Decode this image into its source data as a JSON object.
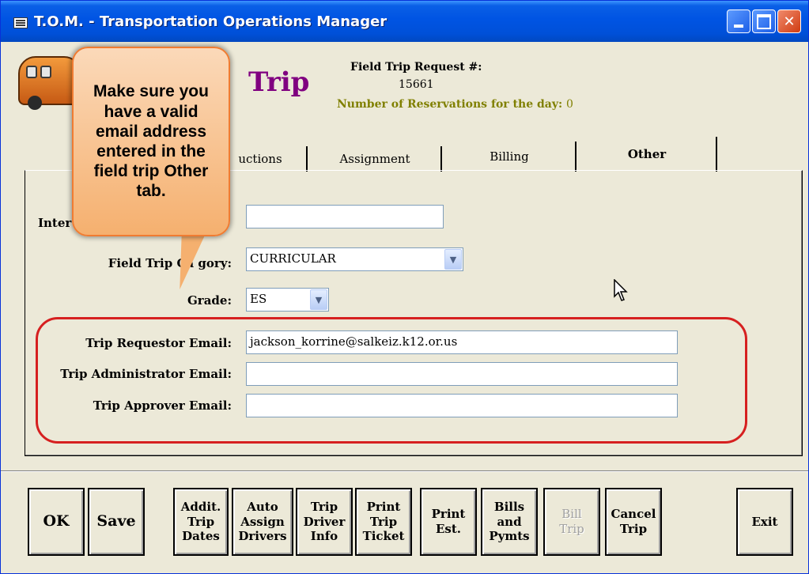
{
  "window": {
    "title": "T.O.M. - Transportation Operations Manager"
  },
  "header": {
    "form_title": "Trip",
    "request_label": "Field Trip Request #:",
    "request_number": "15661",
    "reservations_label": "Number of Reservations for the day:",
    "reservations_count": "0"
  },
  "tabs": [
    {
      "label": "uctions"
    },
    {
      "label": "Assignment"
    },
    {
      "label": "Billing"
    },
    {
      "label": "Other",
      "active": true
    }
  ],
  "form": {
    "internal_label": "Inter",
    "internal_value": "",
    "category_label": "Field Trip Category:",
    "category_label_visible": "Field Trip Ca gory:",
    "category_value": "CURRICULAR",
    "grade_label": "Grade:",
    "grade_value": "ES",
    "requestor_email_label": "Trip Requestor Email:",
    "requestor_email_value": "jackson_korrine@salkeiz.k12.or.us",
    "administrator_email_label": "Trip Administrator Email:",
    "administrator_email_value": "",
    "approver_email_label": "Trip Approver Email:",
    "approver_email_value": ""
  },
  "callout": {
    "text": "Make sure you have a valid email address entered in the field trip Other tab."
  },
  "buttons": {
    "ok": "OK",
    "save": "Save",
    "addit_trip_dates": "Addit.\nTrip\nDates",
    "auto_assign_drivers": "Auto\nAssign\nDrivers",
    "trip_driver_info": "Trip\nDriver\nInfo",
    "print_trip_ticket": "Print\nTrip\nTicket",
    "print_est": "Print\nEst.",
    "bills_and_pymts": "Bills\nand\nPymts",
    "bill_trip": "Bill\nTrip",
    "cancel_trip": "Cancel\nTrip",
    "exit": "Exit"
  },
  "colors": {
    "title_bar": "#0054e3",
    "form_title": "#800080",
    "reservations": "#808000",
    "highlight_border": "#d62020",
    "callout_fill": "#f5b06f"
  }
}
